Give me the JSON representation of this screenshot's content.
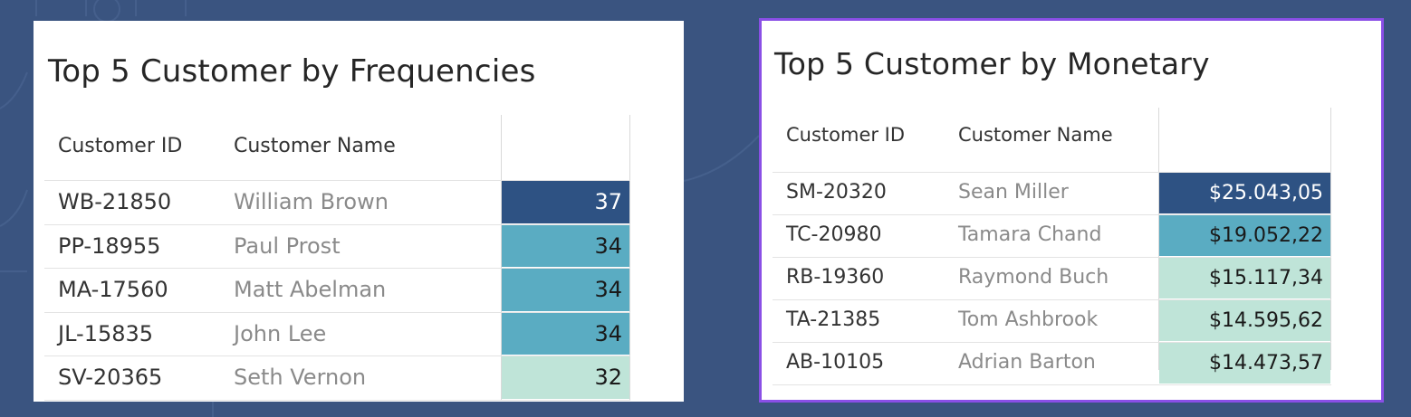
{
  "frequency_table": {
    "title": "Top 5 Customer by Frequencies",
    "columns": [
      "Customer ID",
      "Customer Name",
      ""
    ],
    "rows": [
      {
        "id": "WB-21850",
        "name": "William Brown",
        "value": "37",
        "color": "#2e5283",
        "text_color": "#ffffff"
      },
      {
        "id": "PP-18955",
        "name": "Paul Prost",
        "value": "34",
        "color": "#5aacc2",
        "text_color": "#1a1a1a"
      },
      {
        "id": "MA-17560",
        "name": "Matt Abelman",
        "value": "34",
        "color": "#5aacc2",
        "text_color": "#1a1a1a"
      },
      {
        "id": "JL-15835",
        "name": "John Lee",
        "value": "34",
        "color": "#5aacc2",
        "text_color": "#1a1a1a"
      },
      {
        "id": "SV-20365",
        "name": "Seth Vernon",
        "value": "32",
        "color": "#bfe4d8",
        "text_color": "#1a1a1a"
      }
    ]
  },
  "monetary_table": {
    "title": "Top 5 Customer by Monetary",
    "columns": [
      "Customer ID",
      "Customer Name",
      ""
    ],
    "rows": [
      {
        "id": "SM-20320",
        "name": "Sean Miller",
        "value": "$25.043,05",
        "color": "#2e5283",
        "text_color": "#ffffff"
      },
      {
        "id": "TC-20980",
        "name": "Tamara Chand",
        "value": "$19.052,22",
        "color": "#5aacc2",
        "text_color": "#1a1a1a"
      },
      {
        "id": "RB-19360",
        "name": "Raymond Buch",
        "value": "$15.117,34",
        "color": "#bfe4d8",
        "text_color": "#1a1a1a"
      },
      {
        "id": "TA-21385",
        "name": "Tom Ashbrook",
        "value": "$14.595,62",
        "color": "#bfe4d8",
        "text_color": "#1a1a1a"
      },
      {
        "id": "AB-10105",
        "name": "Adrian Barton",
        "value": "$14.473,57",
        "color": "#bfe4d8",
        "text_color": "#1a1a1a"
      }
    ]
  },
  "colors": {
    "background": "#3a5480",
    "selected_border": "#8a4fe6"
  }
}
